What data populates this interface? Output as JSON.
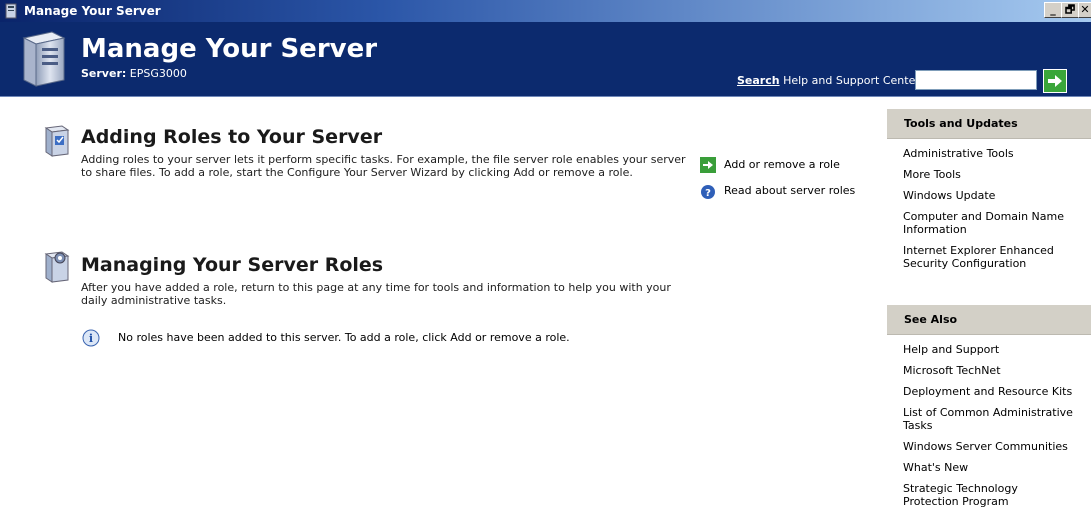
{
  "window": {
    "title": "Manage Your Server",
    "minimize": "_",
    "restore": "🗗",
    "close": "✕"
  },
  "banner": {
    "headline": "Manage Your Server",
    "server_label": "Server:",
    "server_name": "EPSG3000",
    "search_label_bold": "Search",
    "search_label_rest": " Help and Support Center",
    "search_value": ""
  },
  "sections": {
    "adding": {
      "title": "Adding Roles to Your Server",
      "description": "Adding roles to your server lets it perform specific tasks. For example, the file server role enables your server to share files. To add a role, start the Configure Your Server Wizard by clicking Add or remove a role.",
      "link_add": "Add or remove a role",
      "link_read": "Read about server roles"
    },
    "managing": {
      "title": "Managing Your Server Roles",
      "description": "After you have added a role, return to this page at any time for tools and information to help you with your daily administrative tasks.",
      "info": "No roles have been added to this server. To add a role, click Add or remove a role."
    }
  },
  "tools": {
    "heading": "Tools and Updates",
    "items": [
      "Administrative Tools",
      "More Tools",
      "Windows Update",
      "Computer and Domain Name Information",
      "Internet Explorer Enhanced Security Configuration"
    ]
  },
  "see_also": {
    "heading": "See Also",
    "items": [
      "Help and Support",
      "Microsoft TechNet",
      "Deployment and Resource Kits",
      "List of Common Administrative Tasks",
      "Windows Server Communities",
      "What's New",
      "Strategic Technology Protection Program"
    ]
  },
  "colors": {
    "banner": "#0c2a6e",
    "side_heading": "#d3d0c7",
    "go_button": "#3aa63a"
  }
}
